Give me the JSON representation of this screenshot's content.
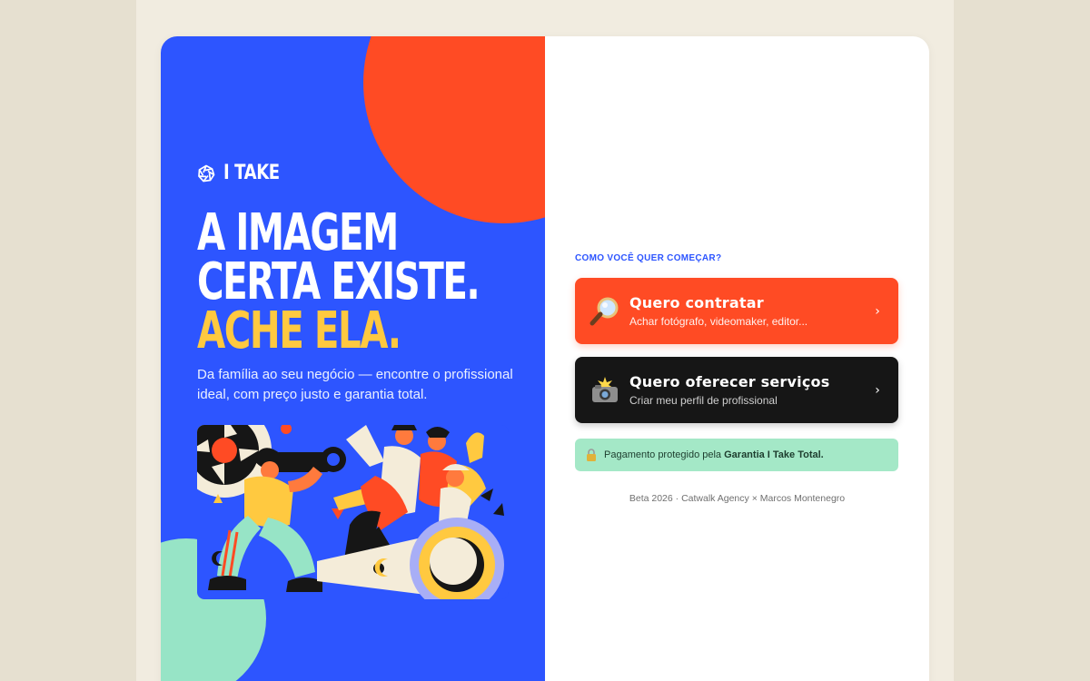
{
  "colors": {
    "page_bg": "#f1ece0",
    "hero_blue": "#2d55ff",
    "accent_orange": "#ff4b24",
    "accent_yellow": "#ffc940",
    "mint": "#97e4c6",
    "dark": "#161616",
    "guarantee_bg": "#a4e8c7"
  },
  "brand": {
    "name": "I TAKE",
    "icon": "aperture-icon"
  },
  "hero": {
    "headline_line1": "A IMAGEM",
    "headline_line2": "CERTA EXISTE.",
    "headline_accent": "ACHE ELA.",
    "subtitle": "Da família ao seu negócio — encontre o profissional ideal, com preço justo e garantia total.",
    "illustration": "photographer-and-crowd-illustration"
  },
  "onboarding": {
    "prompt": "COMO VOCÊ QUER COMEÇAR?",
    "options": [
      {
        "icon": "magnifier-icon",
        "title": "Quero contratar",
        "description": "Achar fotógrafo, videomaker, editor..."
      },
      {
        "icon": "camera-flash-icon",
        "title": "Quero oferecer serviços",
        "description": "Criar meu perfil de profissional"
      }
    ],
    "chevron": "›",
    "guarantee": {
      "icon": "lock-icon",
      "text": "Pagamento protegido pela",
      "highlight": "Garantia I Take Total."
    },
    "footer": "Beta 2026 · Catwalk Agency × Marcos Montenegro"
  }
}
